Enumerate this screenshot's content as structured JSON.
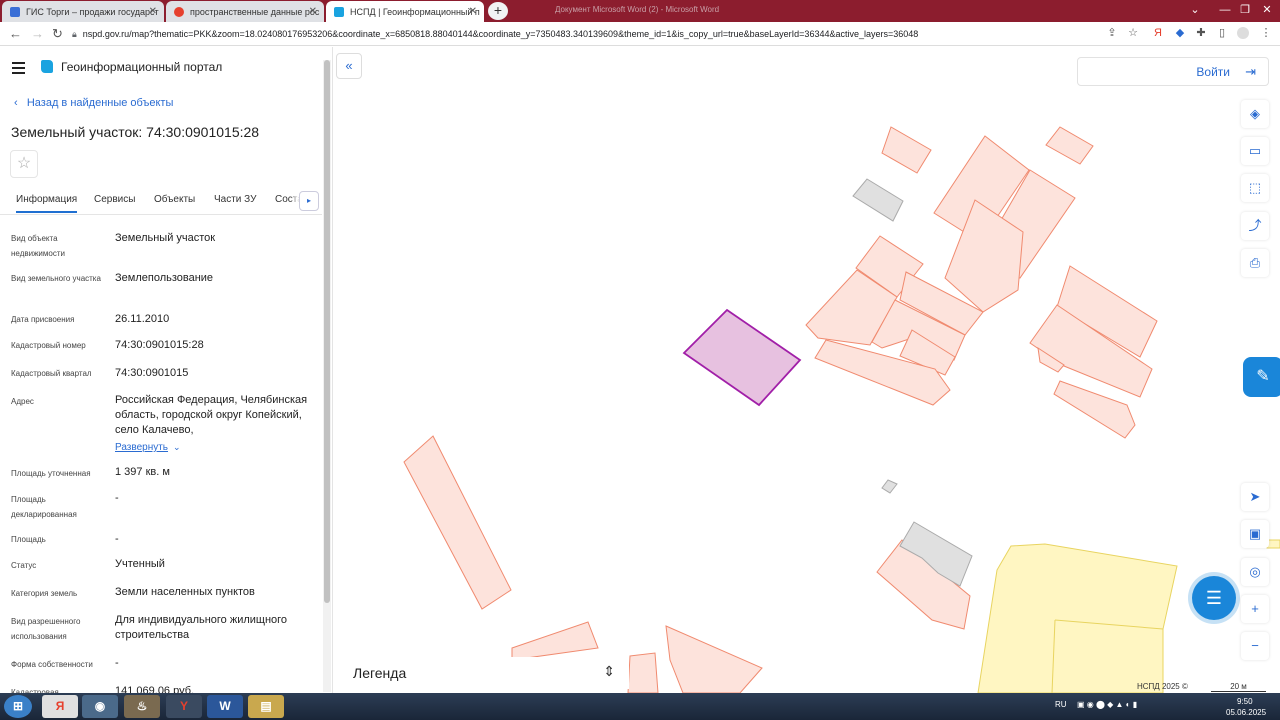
{
  "browser": {
    "tabs": [
      {
        "label": "ГИС Торги – продажи государст",
        "active": false
      },
      {
        "label": "пространственные данные рос",
        "active": false
      },
      {
        "label": "НСПД | Геоинформационный п",
        "active": true
      }
    ],
    "new_tab": "+",
    "background_window_title": "Документ Microsoft Word (2) - Microsoft Word",
    "url": "nspd.gov.ru/map?thematic=PKK&zoom=18.024080176953206&coordinate_x=6850818.88040144&coordinate_y=7350483.340139609&theme_id=1&is_copy_url=true&baseLayerId=36344&active_layers=36048"
  },
  "panel": {
    "brand": "Геоинформационный портал",
    "back_link": "Назад в найденные объекты",
    "title": "Земельный участок: 74:30:0901015:28",
    "tabs": [
      "Информация",
      "Сервисы",
      "Объекты",
      "Части ЗУ",
      "Соста"
    ],
    "fields": [
      {
        "label": "Вид объекта недвижимости",
        "value": "Земельный участок"
      },
      {
        "label": "Вид земельного участка",
        "value": "Землепользование"
      },
      {
        "label": "Дата присвоения",
        "value": "26.11.2010"
      },
      {
        "label": "Кадастровый номер",
        "value": "74:30:0901015:28"
      },
      {
        "label": "Кадастровый квартал",
        "value": "74:30:0901015"
      },
      {
        "label": "Адрес",
        "value": "Российская Федерация, Челябинская область, городской округ Копейский, село Калачево,"
      },
      {
        "label": "Площадь уточненная",
        "value": "1 397 кв. м"
      },
      {
        "label": "Площадь декларированная",
        "value": "-"
      },
      {
        "label": "Площадь",
        "value": "-"
      },
      {
        "label": "Статус",
        "value": "Учтенный"
      },
      {
        "label": "Категория земель",
        "value": "Земли населенных пунктов"
      },
      {
        "label": "Вид разрешенного использования",
        "value": "Для индивидуального жилищного строительства"
      },
      {
        "label": "Форма собственности",
        "value": "-"
      },
      {
        "label": "Кадастровая",
        "value": "141 069,06 руб."
      }
    ],
    "expand_link": "Развернуть"
  },
  "map": {
    "login": "Войти",
    "legend": "Легенда",
    "copyright": "НСПД 2025 ©",
    "scale": "20 м",
    "colors": {
      "parcel_fill": "#fde3dc",
      "parcel_stroke": "#f08a6f",
      "selected_fill": "#e7c1e0",
      "selected_stroke": "#a11fa8",
      "building_fill": "#e0e0e0",
      "zone_fill": "#fff6c2",
      "accent": "#1a86d9"
    }
  },
  "taskbar": {
    "lang": "RU",
    "time": "9:50",
    "date": "05.06.2025"
  }
}
